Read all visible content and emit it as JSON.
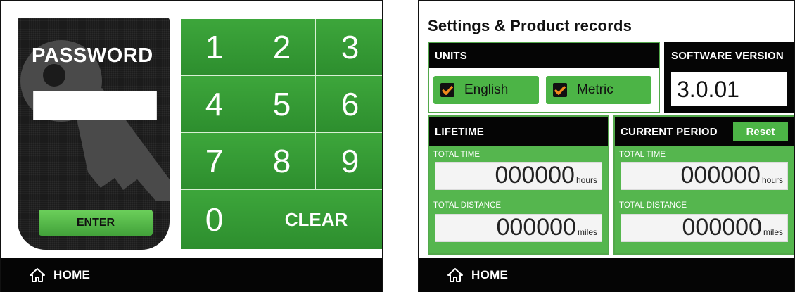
{
  "password_screen": {
    "title": "PASSWORD",
    "input_value": "",
    "enter_label": "ENTER",
    "keys": [
      "1",
      "2",
      "3",
      "4",
      "5",
      "6",
      "7",
      "8",
      "9",
      "0"
    ],
    "clear_label": "CLEAR",
    "nav": {
      "home_label": "HOME",
      "home_icon": "home-icon"
    }
  },
  "settings_screen": {
    "title": "Settings & Product records",
    "units": {
      "header": "UNITS",
      "options": [
        {
          "label": "English",
          "checked": true
        },
        {
          "label": "Metric",
          "checked": true
        }
      ]
    },
    "software_version": {
      "header": "SOFTWARE VERSION",
      "value": "3.0.01"
    },
    "lifetime": {
      "header": "LIFETIME",
      "total_time_label": "TOTAL TIME",
      "total_time_value": "000000",
      "total_time_unit": "hours",
      "total_distance_label": "TOTAL DISTANCE",
      "total_distance_value": "000000",
      "total_distance_unit": "miles"
    },
    "current_period": {
      "header": "CURRENT PERIOD",
      "reset_label": "Reset",
      "total_time_label": "TOTAL TIME",
      "total_time_value": "000000",
      "total_time_unit": "hours",
      "total_distance_label": "TOTAL DISTANCE",
      "total_distance_value": "000000",
      "total_distance_unit": "miles"
    },
    "nav": {
      "home_label": "HOME",
      "home_icon": "home-icon"
    }
  },
  "colors": {
    "accent_green": "#4cb446",
    "check_orange": "#f08a1c",
    "bar_black": "#050505"
  }
}
